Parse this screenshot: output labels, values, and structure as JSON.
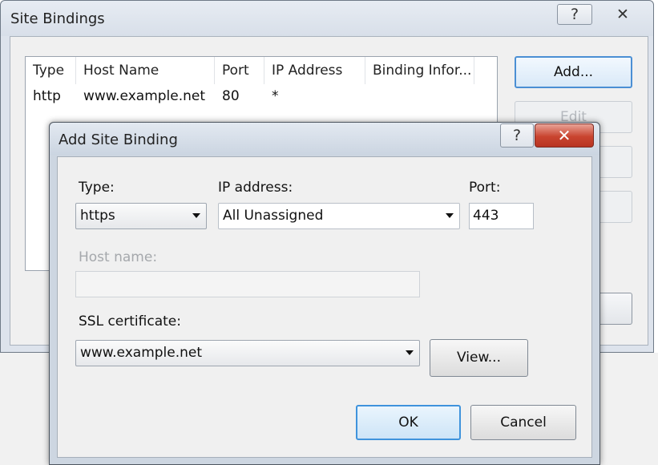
{
  "site_bindings": {
    "title": "Site Bindings",
    "help_glyph": "?",
    "close_glyph": "✕",
    "columns": [
      "Type",
      "Host Name",
      "Port",
      "IP Address",
      "Binding Infor..."
    ],
    "rows": [
      {
        "type": "http",
        "host": "www.example.net",
        "port": "80",
        "ip": "*",
        "info": ""
      }
    ],
    "buttons": {
      "add": "Add...",
      "edit": "Edit"
    }
  },
  "add_binding": {
    "title": "Add Site Binding",
    "help_glyph": "?",
    "close_glyph": "✕",
    "type_label": "Type:",
    "type_value": "https",
    "ip_label": "IP address:",
    "ip_value": "All Unassigned",
    "port_label": "Port:",
    "port_value": "443",
    "host_label": "Host name:",
    "host_value": "",
    "ssl_label": "SSL certificate:",
    "ssl_value": "www.example.net",
    "view_label": "View...",
    "ok_label": "OK",
    "cancel_label": "Cancel"
  },
  "colors": {
    "accent_border": "#3f93dc",
    "close_red": "#c9442f"
  },
  "icons": {
    "help": "help-icon",
    "close": "close-icon",
    "dropdown": "chevron-down-icon"
  }
}
